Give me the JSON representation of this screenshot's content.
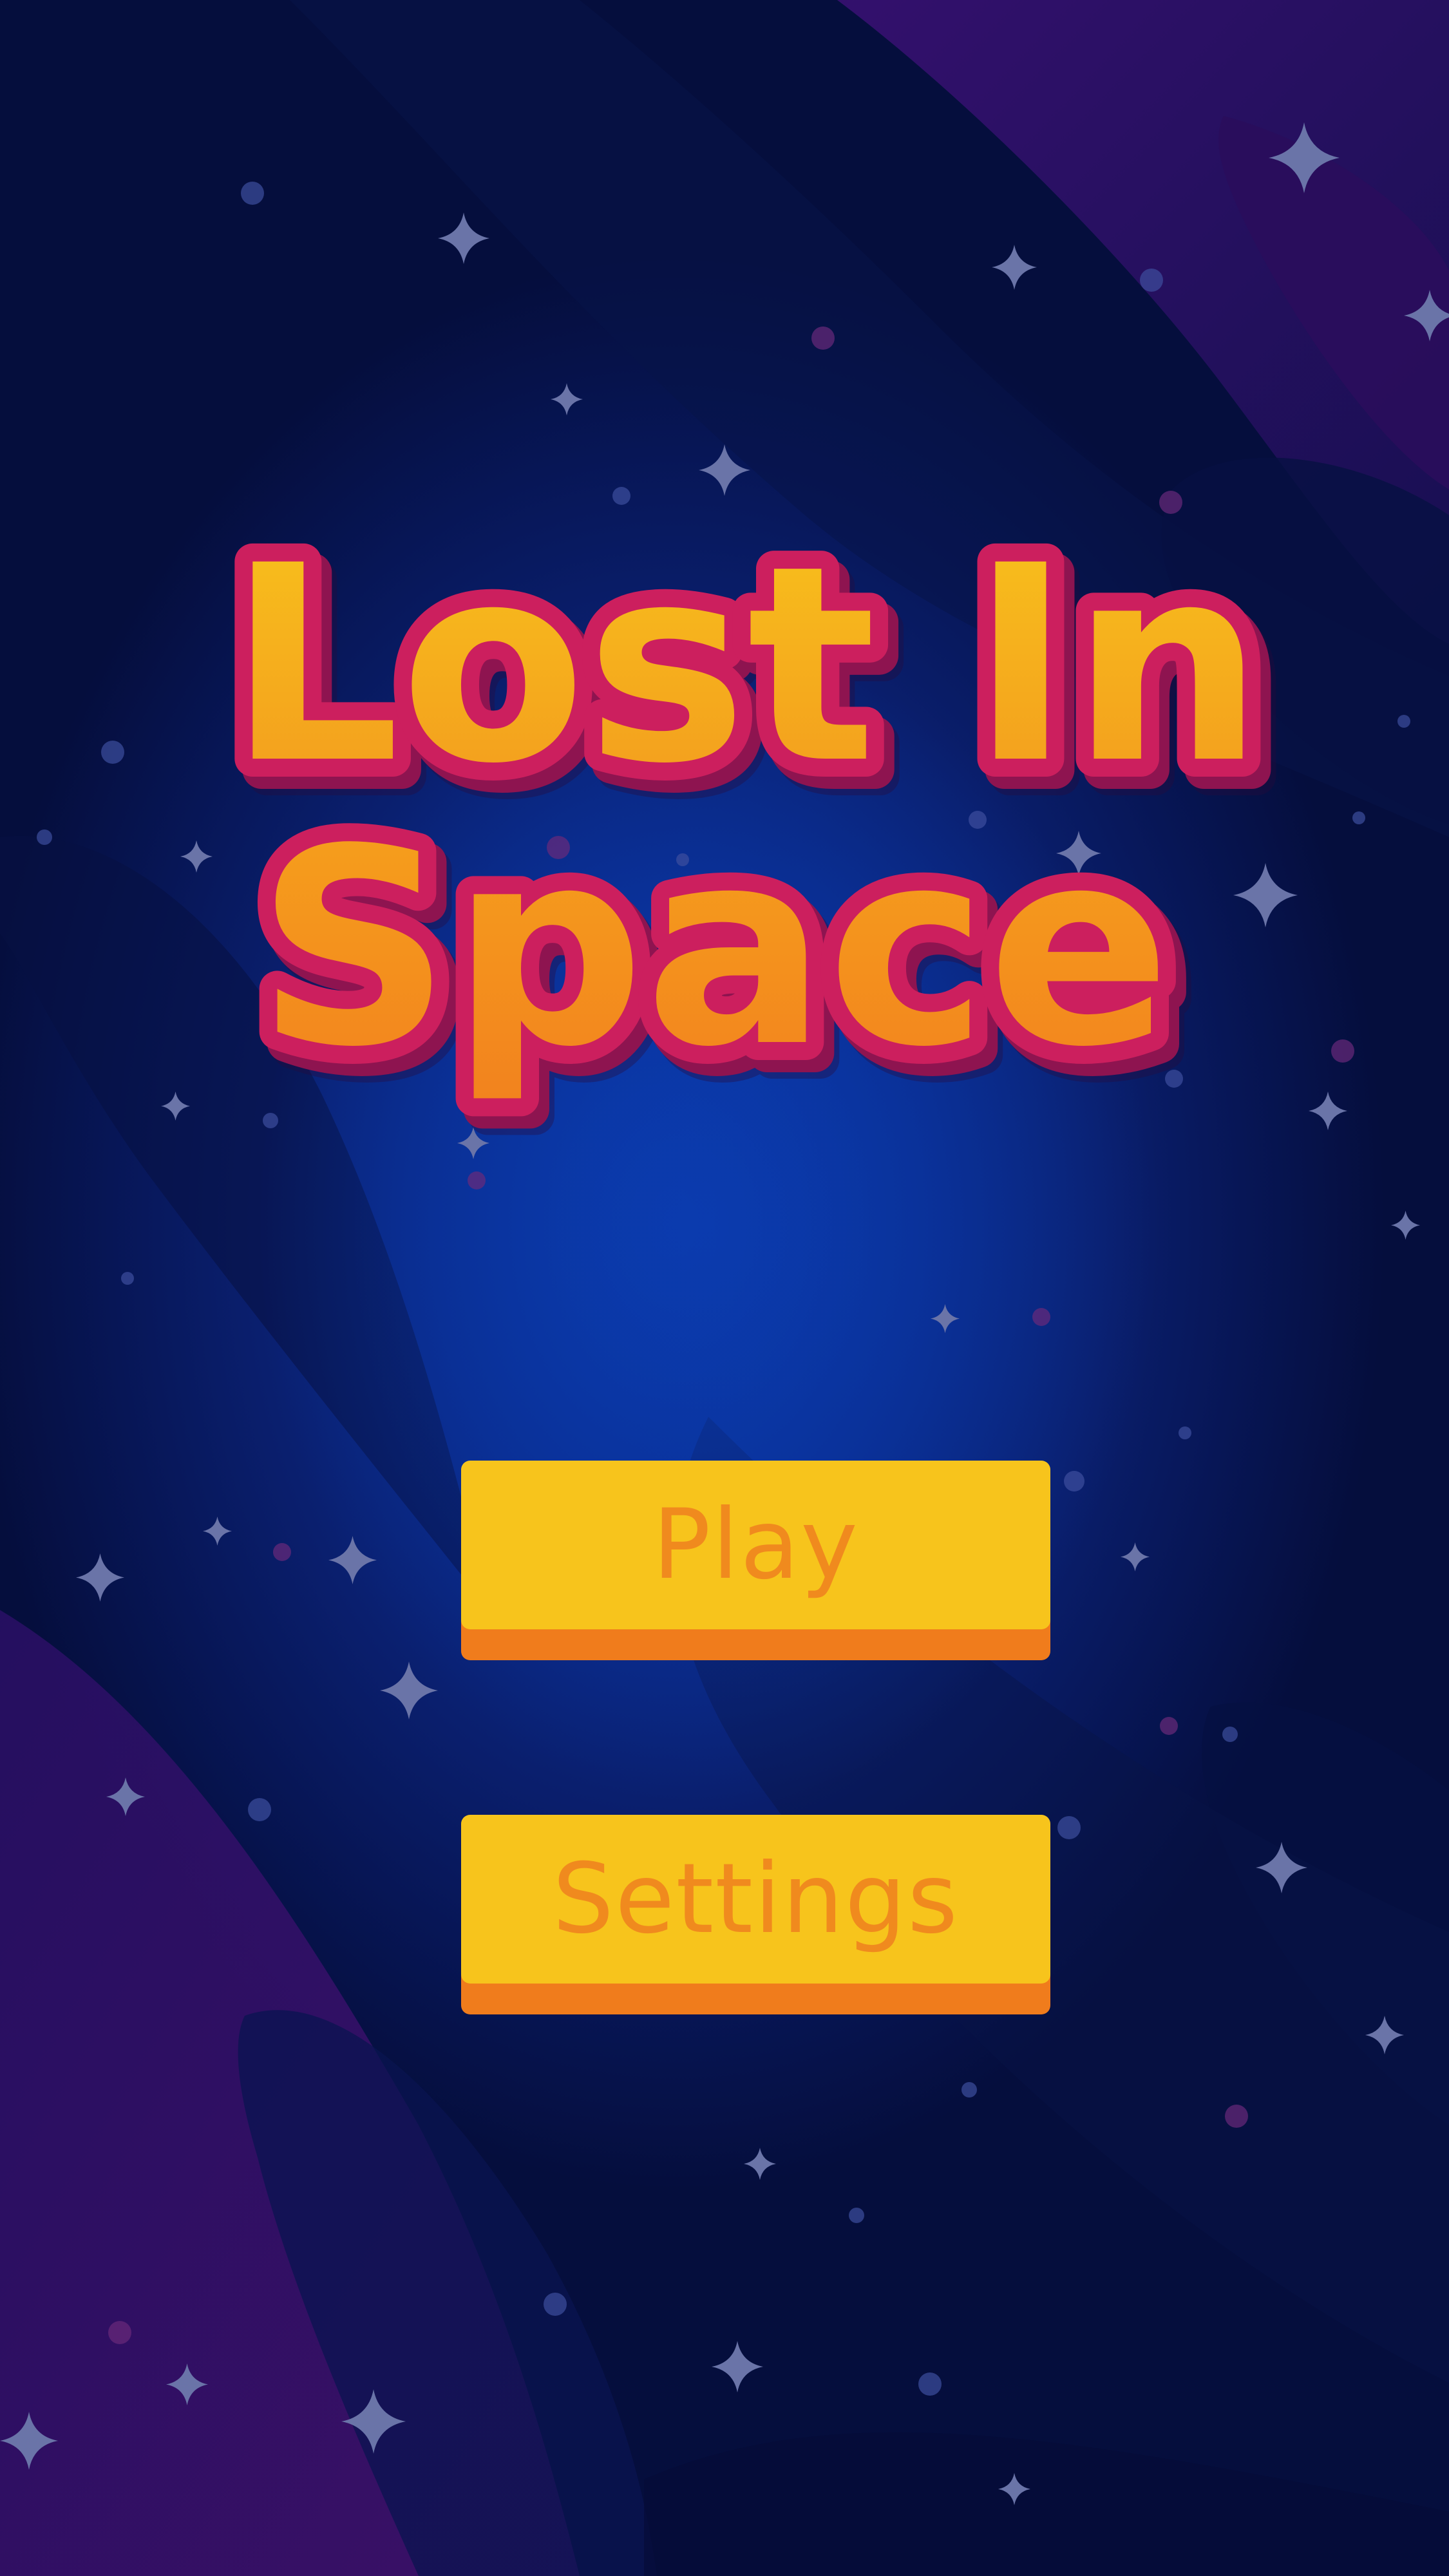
{
  "game": {
    "title_line1": "Lost In",
    "title_line2": "Space"
  },
  "menu": {
    "play_label": "Play",
    "settings_label": "Settings"
  },
  "colors": {
    "background_deep": "#050e3d",
    "background_glow": "#0a38a8",
    "nebula_purple": "#3a0f6e",
    "title_fill_top": "#f8c21c",
    "title_fill_bottom": "#f28a1e",
    "title_outline": "#cc1f5e",
    "title_depth": "#8e1450",
    "button_face": "#f7c41c",
    "button_shadow": "#f07c1c",
    "button_text": "#f08a1e",
    "star": "#6a74a8"
  },
  "icons": {
    "decorative": "sparkle-star-icon"
  }
}
